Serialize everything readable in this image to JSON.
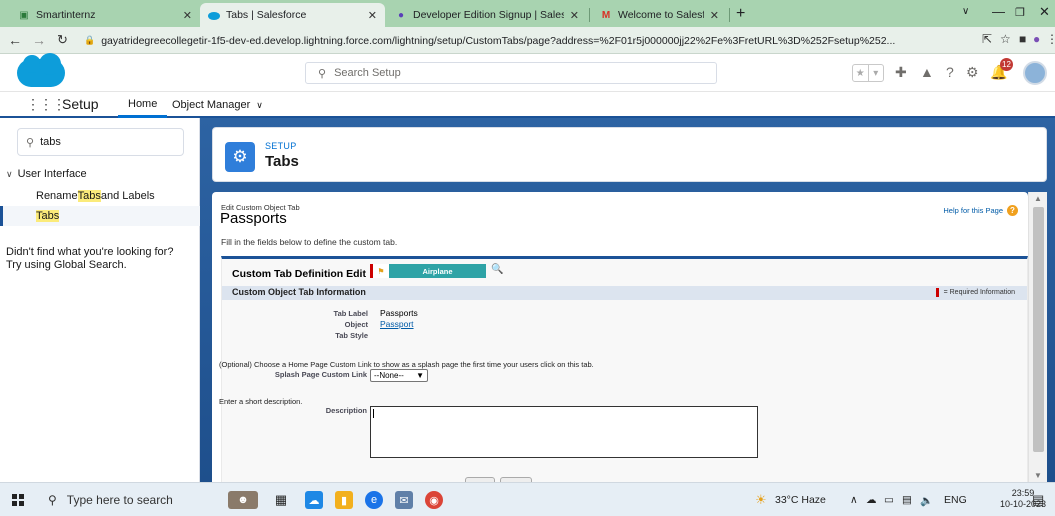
{
  "browser": {
    "tabs": [
      {
        "label": "Smartinternz",
        "active": false
      },
      {
        "label": "Tabs | Salesforce",
        "active": true
      },
      {
        "label": "Developer Edition Signup | Sales",
        "active": false
      },
      {
        "label": "Welcome to Salesforce: Verify yo",
        "active": false
      }
    ],
    "url": "gayatridegreecollegetir-1f5-dev-ed.develop.lightning.force.com/lightning/setup/CustomTabs/page?address=%2F01r5j000000jj22%2Fe%3FretURL%3D%252Fsetup%252...",
    "notification_count": "12"
  },
  "sf_header": {
    "search_placeholder": "Search Setup"
  },
  "setup_nav": {
    "title": "Setup",
    "tabs": [
      "Home",
      "Object Manager"
    ]
  },
  "sidebar": {
    "quick_find_value": "tabs",
    "section": "User Interface",
    "items": [
      {
        "pre": "Rename ",
        "hl": "Tabs",
        "post": " and Labels"
      },
      {
        "pre": "",
        "hl": "Tabs",
        "post": ""
      }
    ],
    "not_found_line1": "Didn't find what you're looking for?",
    "not_found_line2": "Try using Global Search."
  },
  "page_header": {
    "crumb": "SETUP",
    "title": "Tabs"
  },
  "form": {
    "edit_label": "Edit Custom Object Tab",
    "object_title": "Passports",
    "help_link": "Help for this Page",
    "instructions": "Fill in the fields below to define the custom tab.",
    "block_title": "Custom Tab Definition Edit",
    "section_title": "Custom Object Tab Information",
    "required_info": "= Required Information",
    "fields": {
      "tab_label_label": "Tab Label",
      "tab_label_value": "Passports",
      "object_label": "Object",
      "object_value": "Passport",
      "tab_style_label": "Tab Style",
      "tab_style_value": "Airplane",
      "optional_line": "(Optional) Choose a Home Page Custom Link to show as a splash page the first time your users click on this tab.",
      "splash_label": "Splash Page Custom Link",
      "splash_value": "--None--",
      "short_desc_line": "Enter a short description.",
      "description_label": "Description"
    }
  },
  "taskbar": {
    "search_placeholder": "Type here to search",
    "weather": "33°C  Haze",
    "lang": "ENG",
    "time": "23:59",
    "date": "10-10-2023"
  }
}
